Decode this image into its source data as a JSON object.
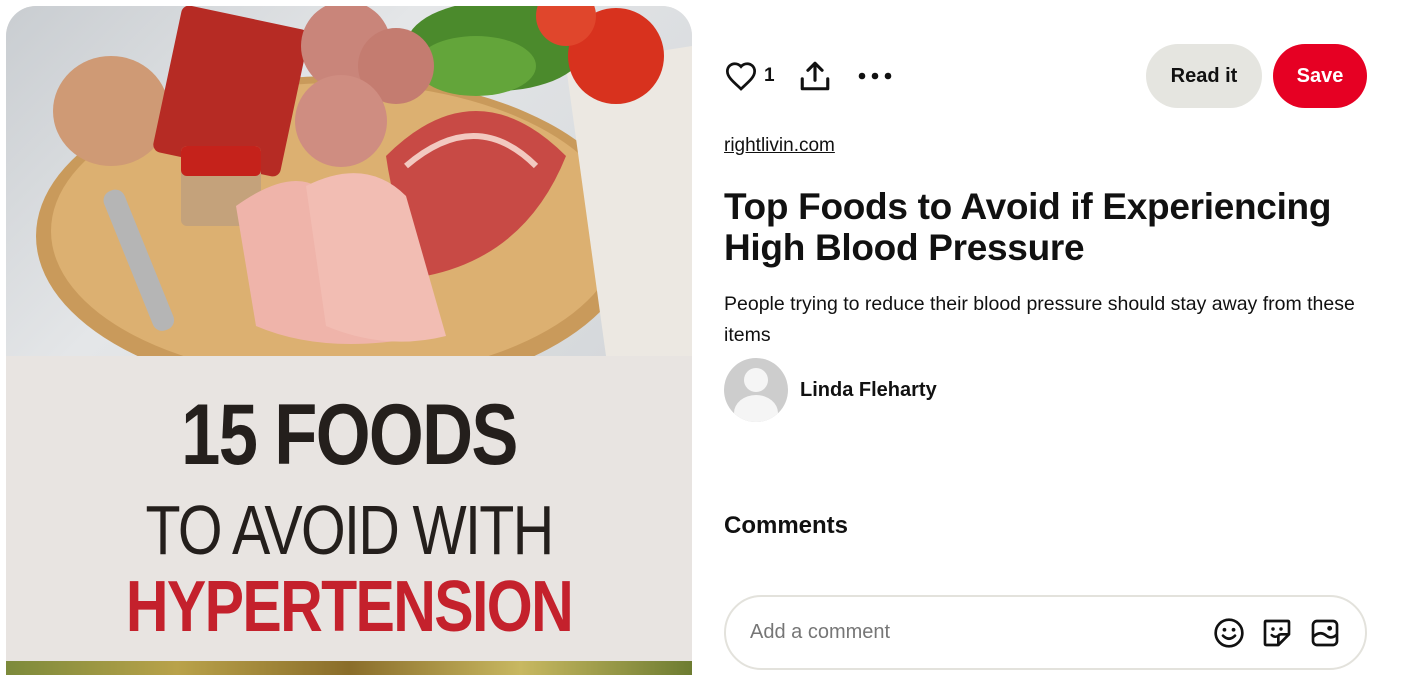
{
  "pin": {
    "image": {
      "headline_line1": "15 FOODS",
      "headline_line2": "TO AVOID WITH",
      "headline_line3": "HYPERTENSION",
      "accent_color": "#c4212c"
    },
    "actions": {
      "like_icon": "heart-icon",
      "like_count": "1",
      "share_icon": "share-icon",
      "more_icon": "more-icon",
      "read_label": "Read it",
      "save_label": "Save",
      "save_color": "#e60023"
    },
    "source": "rightlivin.com",
    "title": "Top Foods to Avoid if Experiencing High Blood Pressure",
    "description": "People trying to reduce their blood pressure should stay away from these items",
    "author": {
      "name": "Linda Fleharty",
      "avatar_icon": "default-avatar-icon"
    }
  },
  "comments": {
    "heading": "Comments",
    "placeholder": "Add a comment",
    "icons": [
      "emoji-icon",
      "sticker-icon",
      "image-icon"
    ]
  }
}
